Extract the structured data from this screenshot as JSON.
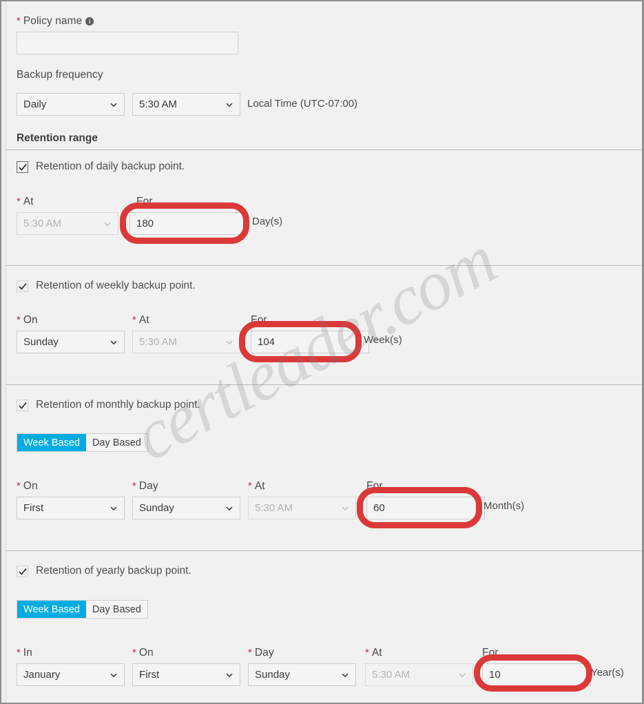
{
  "form": {
    "policy_name": {
      "label": "Policy name",
      "required_marker": "*",
      "info_icon": "info-icon",
      "value": "",
      "placeholder": ""
    },
    "backup_frequency": {
      "label": "Backup frequency",
      "frequency_value": "Daily",
      "time_value": "5:30 AM",
      "timezone_label": "Local Time (UTC-07:00)"
    },
    "retention_range": {
      "title": "Retention range"
    },
    "daily": {
      "checkbox_label": "Retention of daily backup point.",
      "checked": true,
      "at_label": "At",
      "at_value": "5:30 AM",
      "at_disabled": true,
      "for_label": "For",
      "for_value": "180",
      "unit": "Day(s)"
    },
    "weekly": {
      "checkbox_label": "Retention of weekly backup point.",
      "checked": true,
      "on_label": "On",
      "on_value": "Sunday",
      "at_label": "At",
      "at_value": "5:30 AM",
      "at_disabled": true,
      "for_label": "For",
      "for_value": "104",
      "unit": "Week(s)"
    },
    "monthly": {
      "checkbox_label": "Retention of monthly backup point.",
      "checked": true,
      "toggle": {
        "week_based": "Week Based",
        "day_based": "Day Based",
        "selected": "Week Based"
      },
      "on_label": "On",
      "on_value": "First",
      "day_label": "Day",
      "day_value": "Sunday",
      "at_label": "At",
      "at_value": "5:30 AM",
      "at_disabled": true,
      "for_label": "For",
      "for_value": "60",
      "unit": "Month(s)"
    },
    "yearly": {
      "checkbox_label": "Retention of yearly backup point.",
      "checked": true,
      "toggle": {
        "week_based": "Week Based",
        "day_based": "Day Based",
        "selected": "Week Based"
      },
      "in_label": "In",
      "in_value": "January",
      "on_label": "On",
      "on_value": "First",
      "day_label": "Day",
      "day_value": "Sunday",
      "at_label": "At",
      "at_value": "5:30 AM",
      "at_disabled": true,
      "for_label": "For",
      "for_value": "10",
      "unit": "Year(s)"
    }
  },
  "watermark": {
    "text": "certleader.com"
  },
  "colors": {
    "accent_toggle": "#00ace2",
    "annotation_red": "#d92b2b",
    "required_star": "#b0344c",
    "background": "#f1f1f1"
  }
}
